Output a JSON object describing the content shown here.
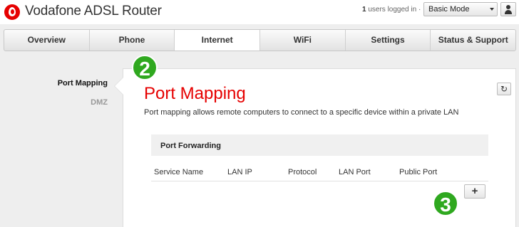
{
  "header": {
    "title": "Vodafone ADSL Router",
    "users_count": "1",
    "users_text": "users logged in ·",
    "mode_selected": "Basic Mode"
  },
  "nav": {
    "tabs": [
      {
        "label": "Overview",
        "active": false
      },
      {
        "label": "Phone",
        "active": false
      },
      {
        "label": "Internet",
        "active": true
      },
      {
        "label": "WiFi",
        "active": false
      },
      {
        "label": "Settings",
        "active": false
      },
      {
        "label": "Status & Support",
        "active": false
      }
    ]
  },
  "subnav": {
    "items": [
      {
        "label": "Port Mapping",
        "active": true
      },
      {
        "label": "DMZ",
        "active": false
      }
    ]
  },
  "main": {
    "title": "Port Mapping",
    "description": "Port mapping allows remote computers to connect to a specific device within a private LAN",
    "section_title": "Port Forwarding",
    "table_headers": [
      "Service Name",
      "LAN IP",
      "Protocol",
      "LAN Port",
      "Public Port"
    ],
    "add_label": "+",
    "refresh_icon": "↻"
  },
  "markers": {
    "step2": "2",
    "step3": "3"
  },
  "colors": {
    "brand_red": "#e60000",
    "marker_green": "#2fa81f"
  }
}
